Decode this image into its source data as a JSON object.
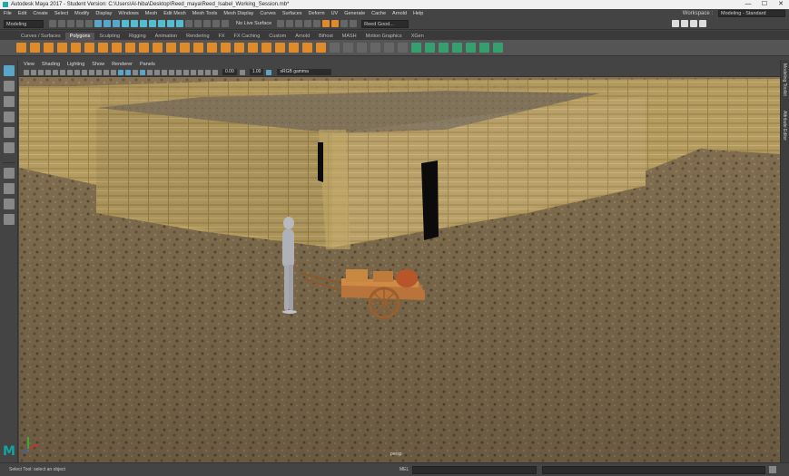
{
  "window": {
    "title": "Autodesk Maya 2017 - Student Version: C:\\Users\\Al-hiba\\Desktop\\Reed_maya\\Reed_Isabel_Working_Session.mb*",
    "controls": [
      "—",
      "☐",
      "✕"
    ]
  },
  "menubar": {
    "items": [
      "File",
      "Edit",
      "Create",
      "Select",
      "Modify",
      "Display",
      "Windows",
      "Mesh",
      "Edit Mesh",
      "Mesh Tools",
      "Mesh Display",
      "Curves",
      "Surfaces",
      "Deform",
      "UV",
      "Generate",
      "Cache",
      "Arnold",
      "Help"
    ],
    "workspace_label": "Workspace :",
    "workspace_value": "Modeling - Standard"
  },
  "statusline": {
    "mode": "Modeling",
    "live_surface": "No Live Surface",
    "render_setting": "Reed Good..."
  },
  "shelf": {
    "tabs": [
      "Curves / Surfaces",
      "Polygons",
      "Sculpting",
      "Rigging",
      "Animation",
      "Rendering",
      "FX",
      "FX Caching",
      "Custom",
      "Arnold",
      "Bifrost",
      "MASH",
      "Motion Graphics",
      "XGen"
    ],
    "active_tab": "Polygons"
  },
  "panel": {
    "menus": [
      "View",
      "Shading",
      "Lighting",
      "Show",
      "Renderer",
      "Panels"
    ],
    "exposure": "0.00",
    "gamma": "1.00",
    "color_management": "sRGB gamma",
    "camera_label": "persp"
  },
  "side_tabs": [
    "Modeling Toolkit",
    "Attribute Editor"
  ],
  "helpline": {
    "text": "Select Tool: select an object",
    "mel_label": "MEL"
  },
  "colors": {
    "ui_bg": "#444444",
    "accent": "#5aa6c8",
    "maya_logo": "#16a3a0",
    "ground": "#8a7556",
    "reed_wall": "#b39a5e"
  }
}
